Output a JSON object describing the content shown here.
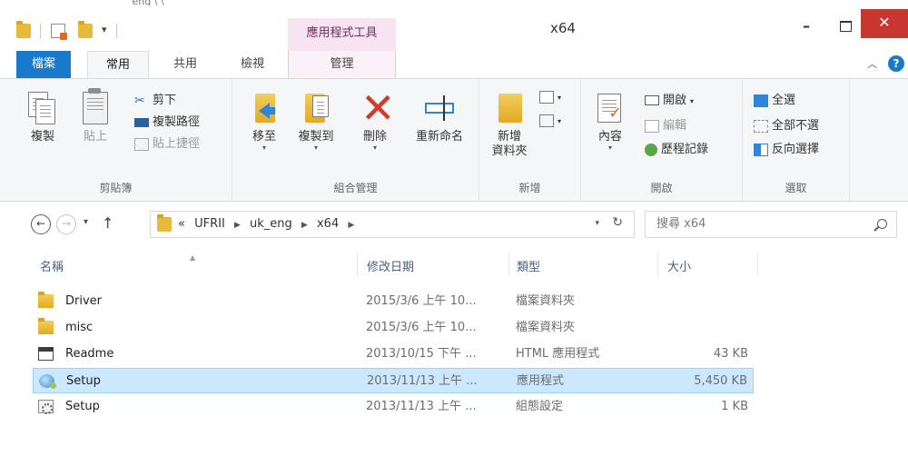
{
  "window": {
    "title": "x64",
    "context_tab_header": "應用程式工具",
    "top_path_fragment": "_eng                                           \\                            \\"
  },
  "ribbon_tabs": [
    {
      "label": "檔案"
    },
    {
      "label": "常用"
    },
    {
      "label": "共用"
    },
    {
      "label": "檢視"
    },
    {
      "label": "管理"
    }
  ],
  "ribbon": {
    "clipboard": {
      "group_label": "剪貼簿",
      "copy": "複製",
      "paste": "貼上",
      "cut": "剪下",
      "copy_path": "複製路徑",
      "paste_shortcut": "貼上捷徑"
    },
    "organize": {
      "group_label": "組合管理",
      "move_to": "移至",
      "copy_to": "複製到",
      "delete": "刪除",
      "rename": "重新命名"
    },
    "new": {
      "group_label": "新增",
      "new_folder_line1": "新增",
      "new_folder_line2": "資料夾"
    },
    "open": {
      "group_label": "開啟",
      "properties": "內容",
      "open": "開啟",
      "edit": "編輯",
      "history": "歷程記錄"
    },
    "select": {
      "group_label": "選取",
      "select_all": "全選",
      "select_none": "全部不選",
      "invert": "反向選擇"
    }
  },
  "address": {
    "overflow": "«",
    "crumbs": [
      "UFRII",
      "uk_eng",
      "x64"
    ],
    "search_placeholder": "搜尋 x64"
  },
  "columns": {
    "name": "名稱",
    "date": "修改日期",
    "type": "類型",
    "size": "大小"
  },
  "files": [
    {
      "name": "Driver",
      "date": "2015/3/6 上午 10...",
      "type": "檔案資料夾",
      "size": "",
      "icon": "folder-icon"
    },
    {
      "name": "misc",
      "date": "2015/3/6 上午 10...",
      "type": "檔案資料夾",
      "size": "",
      "icon": "folder-icon"
    },
    {
      "name": "Readme",
      "date": "2013/10/15 下午 ...",
      "type": "HTML 應用程式",
      "size": "43 KB",
      "icon": "html-app-icon"
    },
    {
      "name": "Setup",
      "date": "2013/11/13 上午 ...",
      "type": "應用程式",
      "size": "5,450 KB",
      "icon": "setup-exe-icon",
      "selected": true
    },
    {
      "name": "Setup",
      "date": "2013/11/13 上午 ...",
      "type": "組態設定",
      "size": "1 KB",
      "icon": "config-file-icon"
    }
  ],
  "colors": {
    "file_tab": "#1979ca",
    "close_button": "#c7372f",
    "context_tab": "#f7e3f1",
    "selection": "#cce8ff"
  }
}
